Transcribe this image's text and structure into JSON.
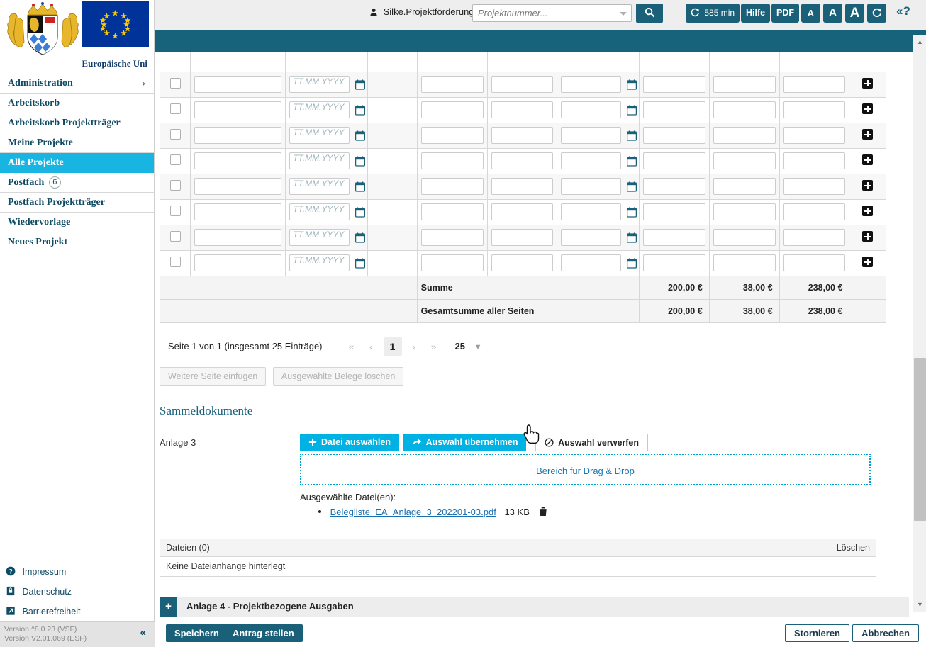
{
  "sidebar": {
    "eu_label": "Europäische Uni",
    "items": [
      {
        "label": "Administration",
        "has_chevron": true,
        "chevron": "›",
        "active": false
      },
      {
        "label": "Arbeitskorb",
        "has_chevron": false,
        "active": false
      },
      {
        "label": "Arbeitskorb Projektträger",
        "has_chevron": false,
        "active": false
      },
      {
        "label": "Meine Projekte",
        "has_chevron": false,
        "active": false
      },
      {
        "label": "Alle Projekte",
        "has_chevron": false,
        "active": true
      },
      {
        "label": "Postfach",
        "badge": "6",
        "has_chevron": false,
        "active": false
      },
      {
        "label": "Postfach Projektträger",
        "has_chevron": false,
        "active": false
      },
      {
        "label": "Wiedervorlage",
        "has_chevron": false,
        "active": false
      },
      {
        "label": "Neues Projekt",
        "has_chevron": false,
        "active": false
      }
    ],
    "footer_links": [
      {
        "label": "Impressum",
        "icon": "question-circle-icon"
      },
      {
        "label": "Datenschutz",
        "icon": "document-lock-icon"
      },
      {
        "label": "Barrierefreiheit",
        "icon": "external-link-icon"
      }
    ],
    "version_line1": "Version ^8.0.23 (VSF)",
    "version_line2": "Version V2.01.069 (ESF)",
    "collapse_icon": "«"
  },
  "topbar": {
    "user_name": "Silke.Projektförderung",
    "user_icon": "user-icon",
    "search_placeholder": "Projektnummer...",
    "search_value": "",
    "search_button_icon": "search-icon",
    "session_timer": "585 min",
    "session_timer_icon": "refresh-icon",
    "help_label": "Hilfe",
    "pdf_label": "PDF",
    "font_small": "A",
    "font_medium": "A",
    "font_large": "A",
    "refresh_icon": "refresh-icon",
    "help_toggle": "«?"
  },
  "table": {
    "rows": 8,
    "date_placeholder": "TT.MM.YYYY",
    "calendar_icon": "calendar-icon",
    "add_row_icon": "plus-icon",
    "summary": [
      {
        "label": "Summe",
        "netto": "200,00 €",
        "ust": "38,00 €",
        "brutto": "238,00 €"
      },
      {
        "label": "Gesamtsumme aller Seiten",
        "netto": "200,00 €",
        "ust": "38,00 €",
        "brutto": "238,00 €"
      }
    ]
  },
  "pagination": {
    "info": "Seite 1 von 1 (insgesamt 25 Einträge)",
    "first": "«",
    "prev": "‹",
    "current_page": "1",
    "next": "›",
    "last": "»",
    "page_size": "25",
    "page_size_caret": "⌄"
  },
  "actions": {
    "insert_page": "Weitere Seite einfügen",
    "delete_selected": "Ausgewählte Belege löschen"
  },
  "sammeldokumente": {
    "title": "Sammeldokumente",
    "anlage_label": "Anlage 3",
    "btn_select_file": "Datei auswählen",
    "btn_select_file_icon": "plus-icon",
    "btn_apply": "Auswahl übernehmen",
    "btn_apply_icon": "share-arrow-icon",
    "btn_discard": "Auswahl verwerfen",
    "btn_discard_icon": "no-entry-icon",
    "dropzone": "Bereich für Drag & Drop",
    "selected_label": "Ausgewählte Datei(en):",
    "files": [
      {
        "name": "Belegliste_EA_Anlage_3_202201-03.pdf",
        "size": "13 KB",
        "delete_icon": "trash-icon"
      }
    ]
  },
  "dateien": {
    "header_name": "Dateien (0)",
    "header_delete": "Löschen",
    "empty_text": "Keine Dateianhänge hinterlegt"
  },
  "anlage4": {
    "expander_icon": "+",
    "label": "Anlage 4 - Projektbezogene Ausgaben"
  },
  "bottombar": {
    "save": "Speichern",
    "submit": "Antrag stellen",
    "cancel_order": "Stornieren",
    "abort": "Abbrechen"
  },
  "scrollbar": {
    "up_icon": "▲",
    "down_icon": "▼"
  },
  "colors": {
    "teal": "#18637c",
    "teal_dark": "#1a6078",
    "cyan": "#00b2e3",
    "sidebar_active": "#18b5e3",
    "link": "#1a6fb0"
  }
}
